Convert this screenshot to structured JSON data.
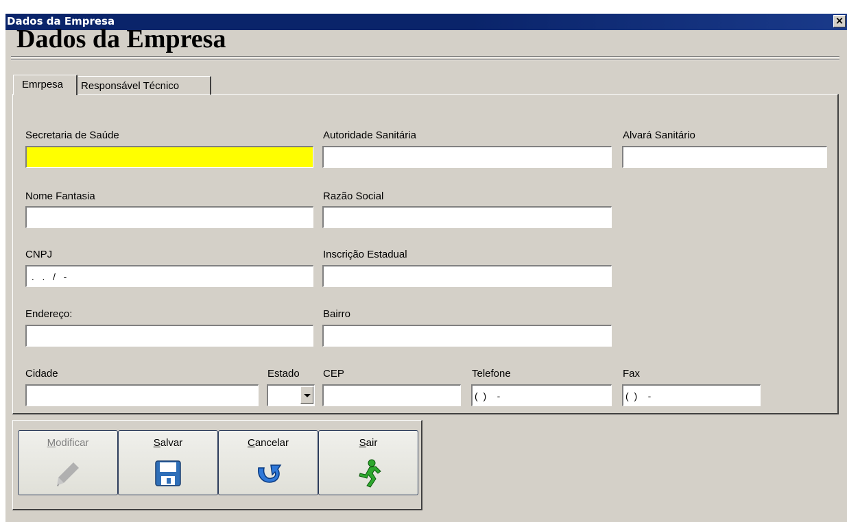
{
  "window": {
    "title": "Dados da Empresa",
    "close_glyph": "×",
    "heading": "Dados da Empresa"
  },
  "tabs": [
    {
      "label": "Emrpesa",
      "active": true
    },
    {
      "label": "Responsável Técnico",
      "active": false
    }
  ],
  "form": {
    "secretaria": {
      "label": "Secretaria de Saúde",
      "value": ""
    },
    "autoridade": {
      "label": "Autoridade Sanitária",
      "value": ""
    },
    "alvara": {
      "label": "Alvará Sanitário",
      "value": ""
    },
    "nome_fantasia": {
      "label": "Nome Fantasia",
      "value": ""
    },
    "razao_social": {
      "label": "Razão Social",
      "value": ""
    },
    "cnpj": {
      "label": "CNPJ",
      "value": " .   .   /   -"
    },
    "inscricao": {
      "label": "Inscrição Estadual",
      "value": ""
    },
    "endereco": {
      "label": "Endereço:",
      "value": ""
    },
    "bairro": {
      "label": "Bairro",
      "value": ""
    },
    "cidade": {
      "label": "Cidade",
      "value": ""
    },
    "estado": {
      "label": "Estado",
      "value": ""
    },
    "cep": {
      "label": "CEP",
      "value": ""
    },
    "telefone": {
      "label": "Telefone",
      "value": "(  )    -"
    },
    "fax": {
      "label": "Fax",
      "value": "(  )    -"
    }
  },
  "toolbar": {
    "modificar": {
      "hotkey": "M",
      "rest": "odificar",
      "enabled": false,
      "icon": "pencil-icon"
    },
    "salvar": {
      "hotkey": "S",
      "rest": "alvar",
      "enabled": true,
      "icon": "floppy-disk-icon"
    },
    "cancelar": {
      "hotkey": "C",
      "rest": "ancelar",
      "enabled": true,
      "icon": "undo-arrow-icon"
    },
    "sair": {
      "hotkey": "S",
      "rest": "air",
      "enabled": true,
      "icon": "running-man-icon"
    }
  },
  "colors": {
    "titlebar": "#0a246a",
    "window_bg": "#d4d0c8",
    "focused_field": "#ffff00"
  }
}
